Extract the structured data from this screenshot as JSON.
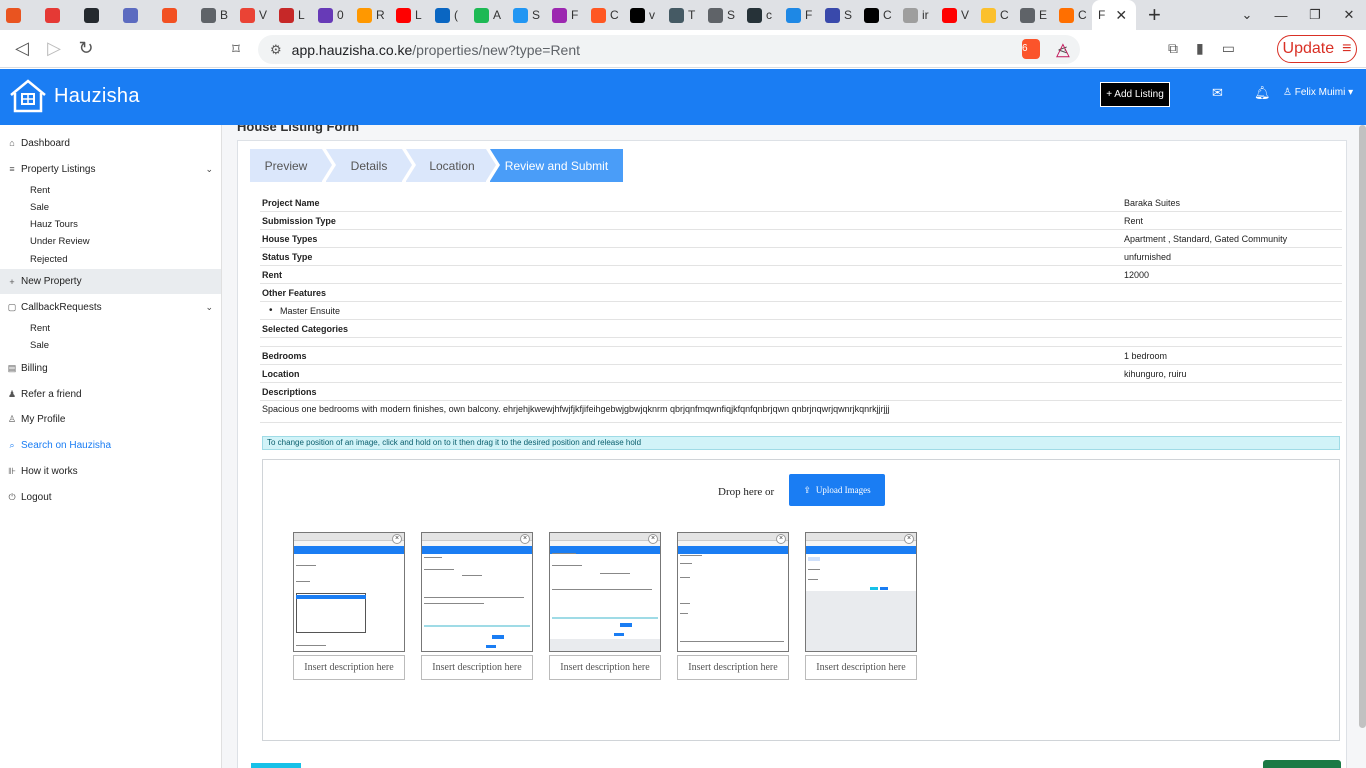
{
  "browser": {
    "tabs": [
      {
        "fav": "#e95420",
        "label": ""
      },
      {
        "fav": "#e53935",
        "label": ""
      },
      {
        "fav": "#24292e",
        "label": ""
      },
      {
        "fav": "#5c6bc0",
        "label": ""
      },
      {
        "fav": "#f25022",
        "label": ""
      },
      {
        "fav": "#5f6368",
        "label": "B"
      },
      {
        "fav": "#ea4335",
        "label": "V"
      },
      {
        "fav": "#c62828",
        "label": "L"
      },
      {
        "fav": "#673ab7",
        "label": "0"
      },
      {
        "fav": "#ff9800",
        "label": "R"
      },
      {
        "fav": "#ff0000",
        "label": "L"
      },
      {
        "fav": "#0a66c2",
        "label": "("
      },
      {
        "fav": "#1db954",
        "label": "A"
      },
      {
        "fav": "#2196f3",
        "label": "S"
      },
      {
        "fav": "#9c27b0",
        "label": "F"
      },
      {
        "fav": "#ff5722",
        "label": "C"
      },
      {
        "fav": "#000000",
        "label": "v"
      },
      {
        "fav": "#455a64",
        "label": "T"
      },
      {
        "fav": "#5f6368",
        "label": "S"
      },
      {
        "fav": "#263238",
        "label": "c"
      },
      {
        "fav": "#1e88e5",
        "label": "F"
      },
      {
        "fav": "#3949ab",
        "label": "S"
      },
      {
        "fav": "#000000",
        "label": "C"
      },
      {
        "fav": "#9e9e9e",
        "label": "ir"
      },
      {
        "fav": "#ff0000",
        "label": "V"
      },
      {
        "fav": "#fbc02d",
        "label": "C"
      },
      {
        "fav": "#5f6368",
        "label": "E"
      },
      {
        "fav": "#ff6f00",
        "label": "C"
      }
    ],
    "active_tab": {
      "label": "F",
      "close": "✕"
    },
    "new_tab": "+",
    "window_controls": [
      "⌄",
      "—",
      "❐",
      "✕"
    ],
    "url_host": "app.hauzisha.co.ke",
    "url_path": "/properties/new?type=Rent",
    "brave_badge": "6",
    "update_label": "Update"
  },
  "header": {
    "brand": "Hauzisha",
    "add_listing": "+ Add Listing",
    "user": "Felix Muimi ▾"
  },
  "sidebar": {
    "dashboard": "Dashboard",
    "property_listings": "Property Listings",
    "listings_sub": [
      "Rent",
      "Sale",
      "Hauz Tours",
      "Under Review",
      "Rejected"
    ],
    "new_property": "New Property",
    "callback_requests": "CallbackRequests",
    "callback_sub": [
      "Rent",
      "Sale"
    ],
    "billing": "Billing",
    "refer": "Refer a friend",
    "profile": "My Profile",
    "search": "Search on Hauzisha",
    "how": "How it works",
    "logout": "Logout"
  },
  "main": {
    "title": "House Listing Form",
    "steps": [
      "Preview",
      "Details",
      "Location",
      "Review and Submit"
    ],
    "review": {
      "project_name_label": "Project Name",
      "project_name": "Baraka Suites",
      "submission_type_label": "Submission Type",
      "submission_type": "Rent",
      "house_types_label": "House Types",
      "house_types": "Apartment , Standard, Gated Community",
      "status_type_label": "Status Type",
      "status_type": "unfurnished",
      "rent_label": "Rent",
      "rent": "12000",
      "other_features_label": "Other Features",
      "features": [
        "Master Ensuite"
      ],
      "selected_categories_label": "Selected Categories",
      "bedrooms_label": "Bedrooms",
      "bedrooms": "1 bedroom",
      "location_label": "Location",
      "location": "kihunguro, ruiru",
      "descriptions_label": "Descriptions",
      "description": "Spacious one bedrooms with modern finishes, own balcony. ehrjehjkwewjhfwjfjkfjifeihgebwjgbwjqknrm qbrjqnfmqwnfiqjkfqnfqnbrjqwn qnbrjnqwrjqwnrjkqnrkjjrjjj"
    },
    "info": "To change position of an image, click and hold on to it then drag it to the desired position and release hold",
    "drop_label": "Drop here or",
    "upload_label": "Upload Images",
    "description_placeholder": "Insert description here",
    "thumb_close": "×"
  }
}
